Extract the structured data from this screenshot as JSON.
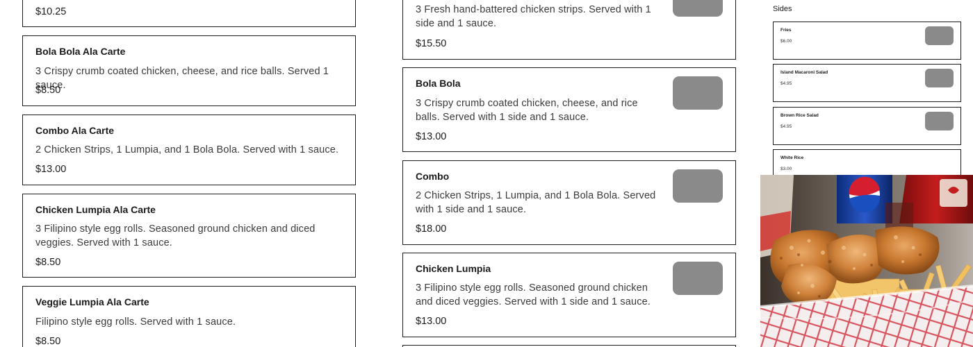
{
  "left_column": {
    "top_price": "$10.25",
    "items": [
      {
        "name": "Bola Bola Ala Carte",
        "description": "3 Crispy crumb coated chicken, cheese, and rice balls. Served 1 sauce.",
        "price": "$8.50"
      },
      {
        "name": "Combo Ala Carte",
        "description": "2 Chicken Strips, 1 Lumpia, and 1 Bola Bola. Served with 1 sauce.",
        "price": "$13.00"
      },
      {
        "name": "Chicken Lumpia Ala Carte",
        "description": "3 Filipino style egg rolls. Seasoned ground chicken and diced veggies. Served with 1 sauce.",
        "price": "$8.50"
      },
      {
        "name": "Veggie Lumpia Ala Carte",
        "description": "Filipino style egg rolls. Served with 1 sauce.",
        "price": "$8.50"
      }
    ]
  },
  "middle_column": {
    "top_item": {
      "description": "3 Fresh hand-battered chicken strips. Served with 1 side and 1 sauce.",
      "price": "$15.50"
    },
    "items": [
      {
        "name": "Bola Bola",
        "description": "3 Crispy crumb coated chicken, cheese, and rice balls. Served with 1 side and 1 sauce.",
        "price": "$13.00"
      },
      {
        "name": "Combo",
        "description": "2 Chicken Strips, 1 Lumpia, and 1 Bola Bola. Served with 1 side and 1 sauce.",
        "price": "$18.00"
      },
      {
        "name": "Chicken Lumpia",
        "description": "3 Filipino style egg rolls. Seasoned ground chicken and diced veggies. Served with 1 side and 1 sauce.",
        "price": "$13.00"
      }
    ]
  },
  "sides": {
    "title": "Sides",
    "items": [
      {
        "name": "Fries",
        "price": "$6.00"
      },
      {
        "name": "Island Macaroni Salad",
        "price": "$4.95"
      },
      {
        "name": "Brown Rice Salad",
        "price": "$4.95"
      },
      {
        "name": "White Rice",
        "price": "$3.00"
      }
    ]
  },
  "colors": {
    "border": "#1a1a1a",
    "thumbnail_placeholder": "#8a8a8a",
    "text": "#1a1a1a"
  }
}
